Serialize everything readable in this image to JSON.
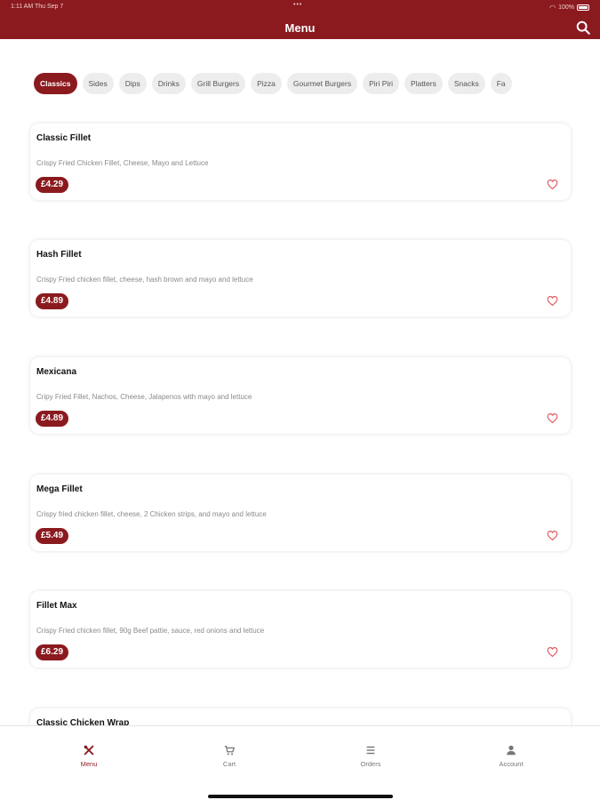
{
  "status_bar": {
    "time": "1:11 AM   Thu Sep 7",
    "battery": "100%"
  },
  "header": {
    "title": "Menu"
  },
  "categories": [
    "Classics",
    "Sides",
    "Dips",
    "Drinks",
    "Grill Burgers",
    "Pizza",
    "Gourmet Burgers",
    "Piri Piri",
    "Platters",
    "Snacks",
    "Fa"
  ],
  "active_category": "Classics",
  "menu_items": [
    {
      "name": "Classic Fillet",
      "description": "Crispy Fried Chicken Fillet, Cheese, Mayo and Lettuce",
      "price": "£4.29"
    },
    {
      "name": "Hash Fillet",
      "description": "Crispy Fried chicken fillet, cheese, hash brown and mayo and lettuce",
      "price": "£4.89"
    },
    {
      "name": "Mexicana",
      "description": "Cripy Fried Fillet, Nachos, Cheese, Jalapenos with mayo and lettuce",
      "price": "£4.89"
    },
    {
      "name": "Mega Fillet",
      "description": "Crispy fried chicken fillet, cheese, 2 Chicken strips, and mayo and lettuce",
      "price": "£5.49"
    },
    {
      "name": "Fillet Max",
      "description": "Crispy Fried chicken fillet, 90g Beef pattie, sauce, red onions and lettuce",
      "price": "£6.29"
    },
    {
      "name": "Classic Chicken Wrap",
      "description": "",
      "price": ""
    }
  ],
  "tabs": [
    {
      "label": "Menu",
      "icon": "utensils-icon"
    },
    {
      "label": "Cart",
      "icon": "cart-icon"
    },
    {
      "label": "Orders",
      "icon": "orders-icon"
    },
    {
      "label": "Account",
      "icon": "account-icon"
    }
  ],
  "colors": {
    "brand": "#8b1a1f",
    "chip_bg": "#ededed",
    "heart": "#e0585c"
  }
}
